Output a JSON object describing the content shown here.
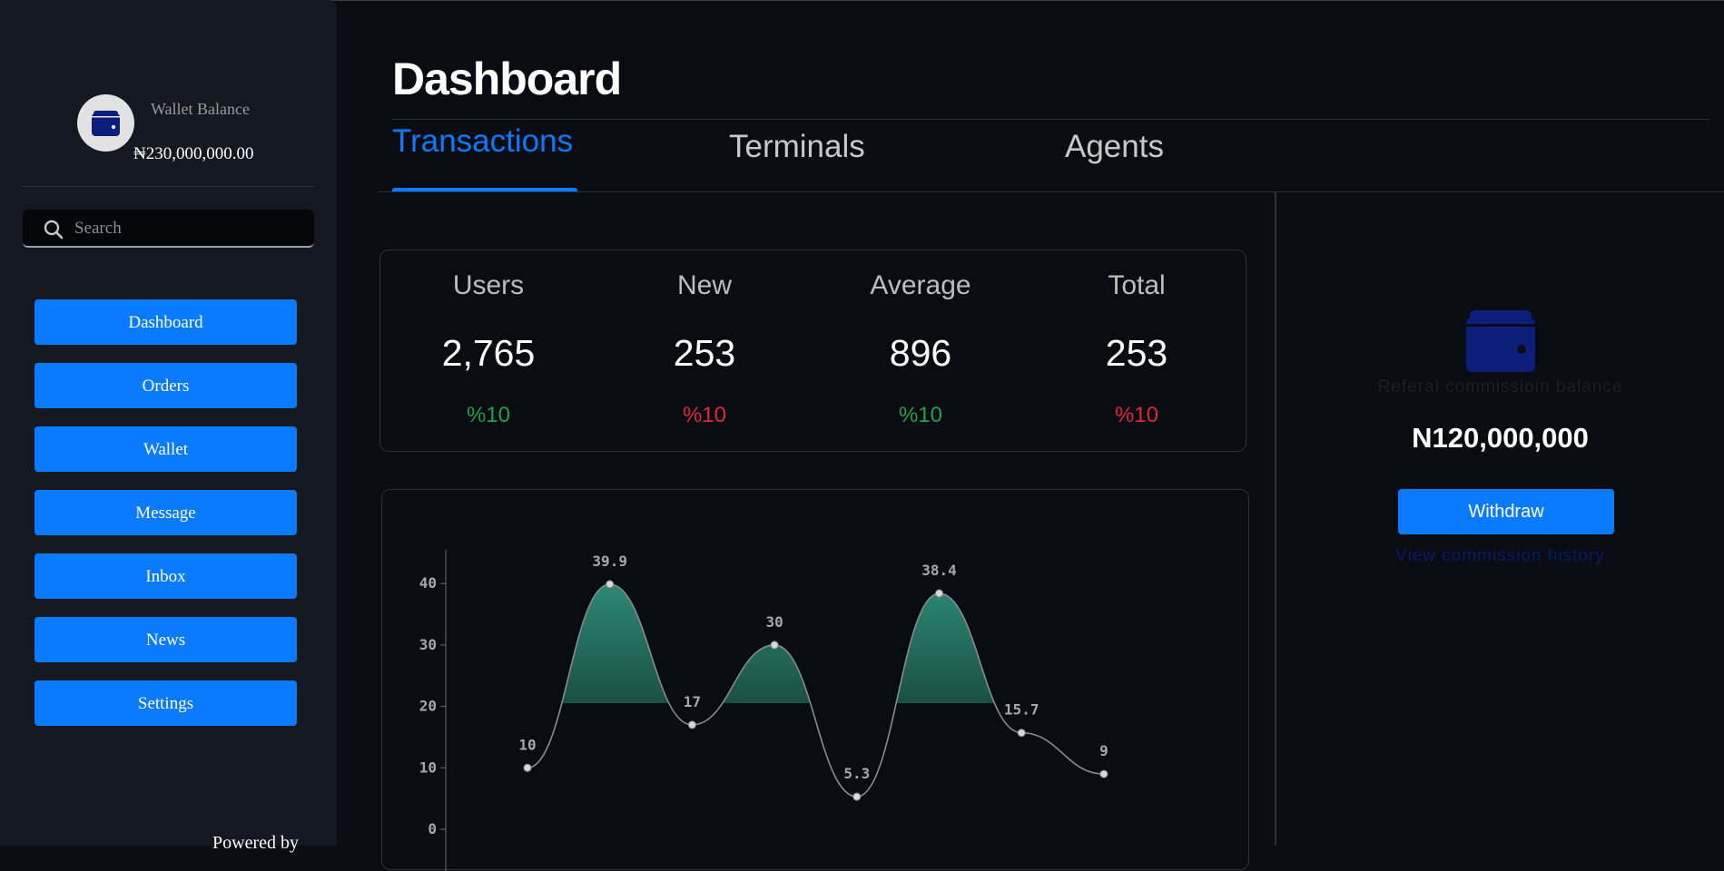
{
  "sidebar": {
    "wallet_label": "Wallet Balance",
    "wallet_amount": "₦230,000,000.00",
    "search_placeholder": "Search",
    "nav_items": [
      {
        "label": "Dashboard"
      },
      {
        "label": "Orders"
      },
      {
        "label": "Wallet"
      },
      {
        "label": "Message"
      },
      {
        "label": "Inbox"
      },
      {
        "label": "News"
      },
      {
        "label": "Settings"
      }
    ],
    "footer_text": "Powered by"
  },
  "header": {
    "title": "Dashboard"
  },
  "tabs": [
    {
      "label": "Transactions",
      "active": true
    },
    {
      "label": "Terminals",
      "active": false
    },
    {
      "label": "Agents",
      "active": false
    }
  ],
  "stats": [
    {
      "label": "Users",
      "value": "2,765",
      "change": "%10",
      "trend": "up"
    },
    {
      "label": "New",
      "value": "253",
      "change": "%10",
      "trend": "down"
    },
    {
      "label": "Average",
      "value": "896",
      "change": "%10",
      "trend": "up"
    },
    {
      "label": "Total",
      "value": "253",
      "change": "%10",
      "trend": "down"
    }
  ],
  "chart_data": {
    "type": "area",
    "title": "",
    "xlabel": "",
    "ylabel": "",
    "categories": [
      "",
      "",
      "",
      "",
      "",
      "",
      "",
      ""
    ],
    "values": [
      10,
      39.9,
      17,
      30,
      5.3,
      38.4,
      15.7,
      9
    ],
    "data_labels": [
      "10",
      "39.9",
      "17",
      "30",
      "5.3",
      "38.4",
      "15.7",
      "9"
    ],
    "y_ticks": [
      0,
      10,
      20,
      30,
      40
    ],
    "ylim": [
      0,
      40
    ],
    "grid": false,
    "line_color": "#8a8a8a",
    "fill_color": "#2f8f7a"
  },
  "referral": {
    "label": "Referal commissioin balance",
    "amount": "N120,000,000",
    "withdraw_label": "Withdraw",
    "history_link": "View commission history"
  },
  "colors": {
    "accent": "#0a7bff",
    "positive": "#25a04a",
    "negative": "#e0283a",
    "wallet_icon": "#0b1f7a"
  }
}
